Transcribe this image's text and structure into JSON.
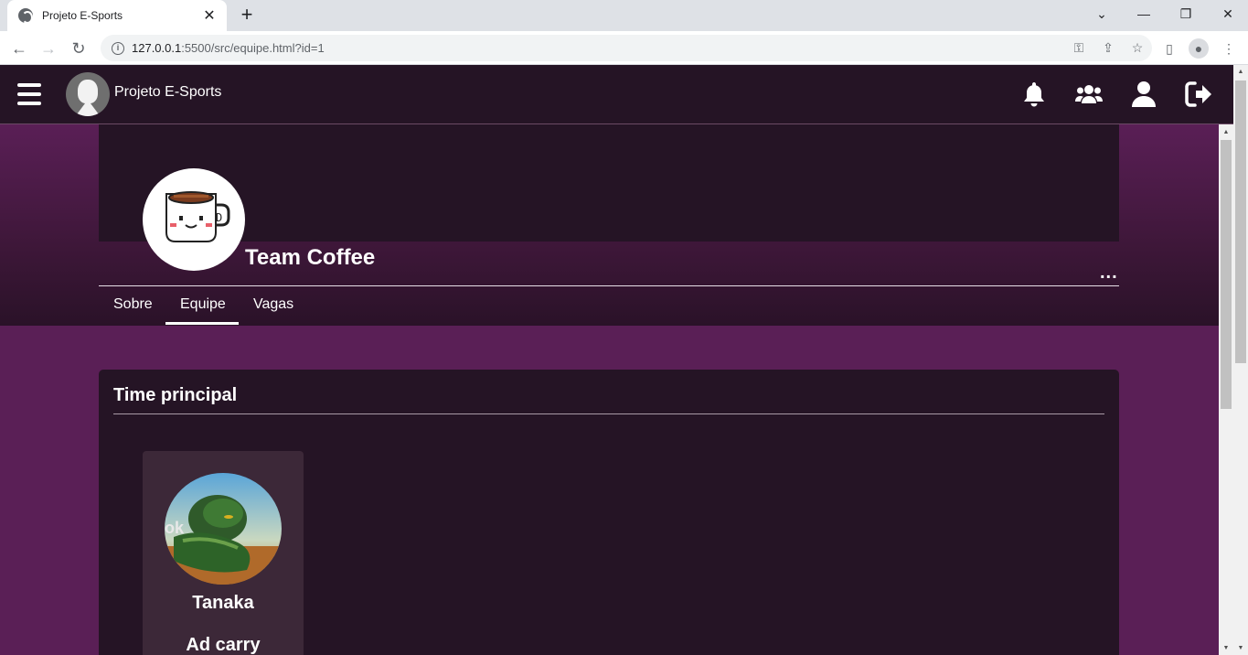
{
  "browser": {
    "tab_title": "Projeto E-Sports",
    "url_host": "127.0.0.1",
    "url_rest": ":5500/src/equipe.html?id=1"
  },
  "navbar": {
    "brand": "Projeto E-Sports",
    "icons": [
      "menu-icon",
      "bell-icon",
      "users-icon",
      "user-icon",
      "logout-icon"
    ]
  },
  "team": {
    "name": "Team Coffee",
    "more_label": "..."
  },
  "tabs": [
    {
      "label": "Sobre",
      "active": false
    },
    {
      "label": "Equipe",
      "active": true
    },
    {
      "label": "Vagas",
      "active": false
    }
  ],
  "roster": {
    "title": "Time principal",
    "players": [
      {
        "name": "Tanaka",
        "role": "Ad carry"
      }
    ]
  },
  "colors": {
    "navbar_bg": "#251425",
    "page_bg": "#5a1f56",
    "card_bg": "#3c2838",
    "text": "#ffffff"
  }
}
